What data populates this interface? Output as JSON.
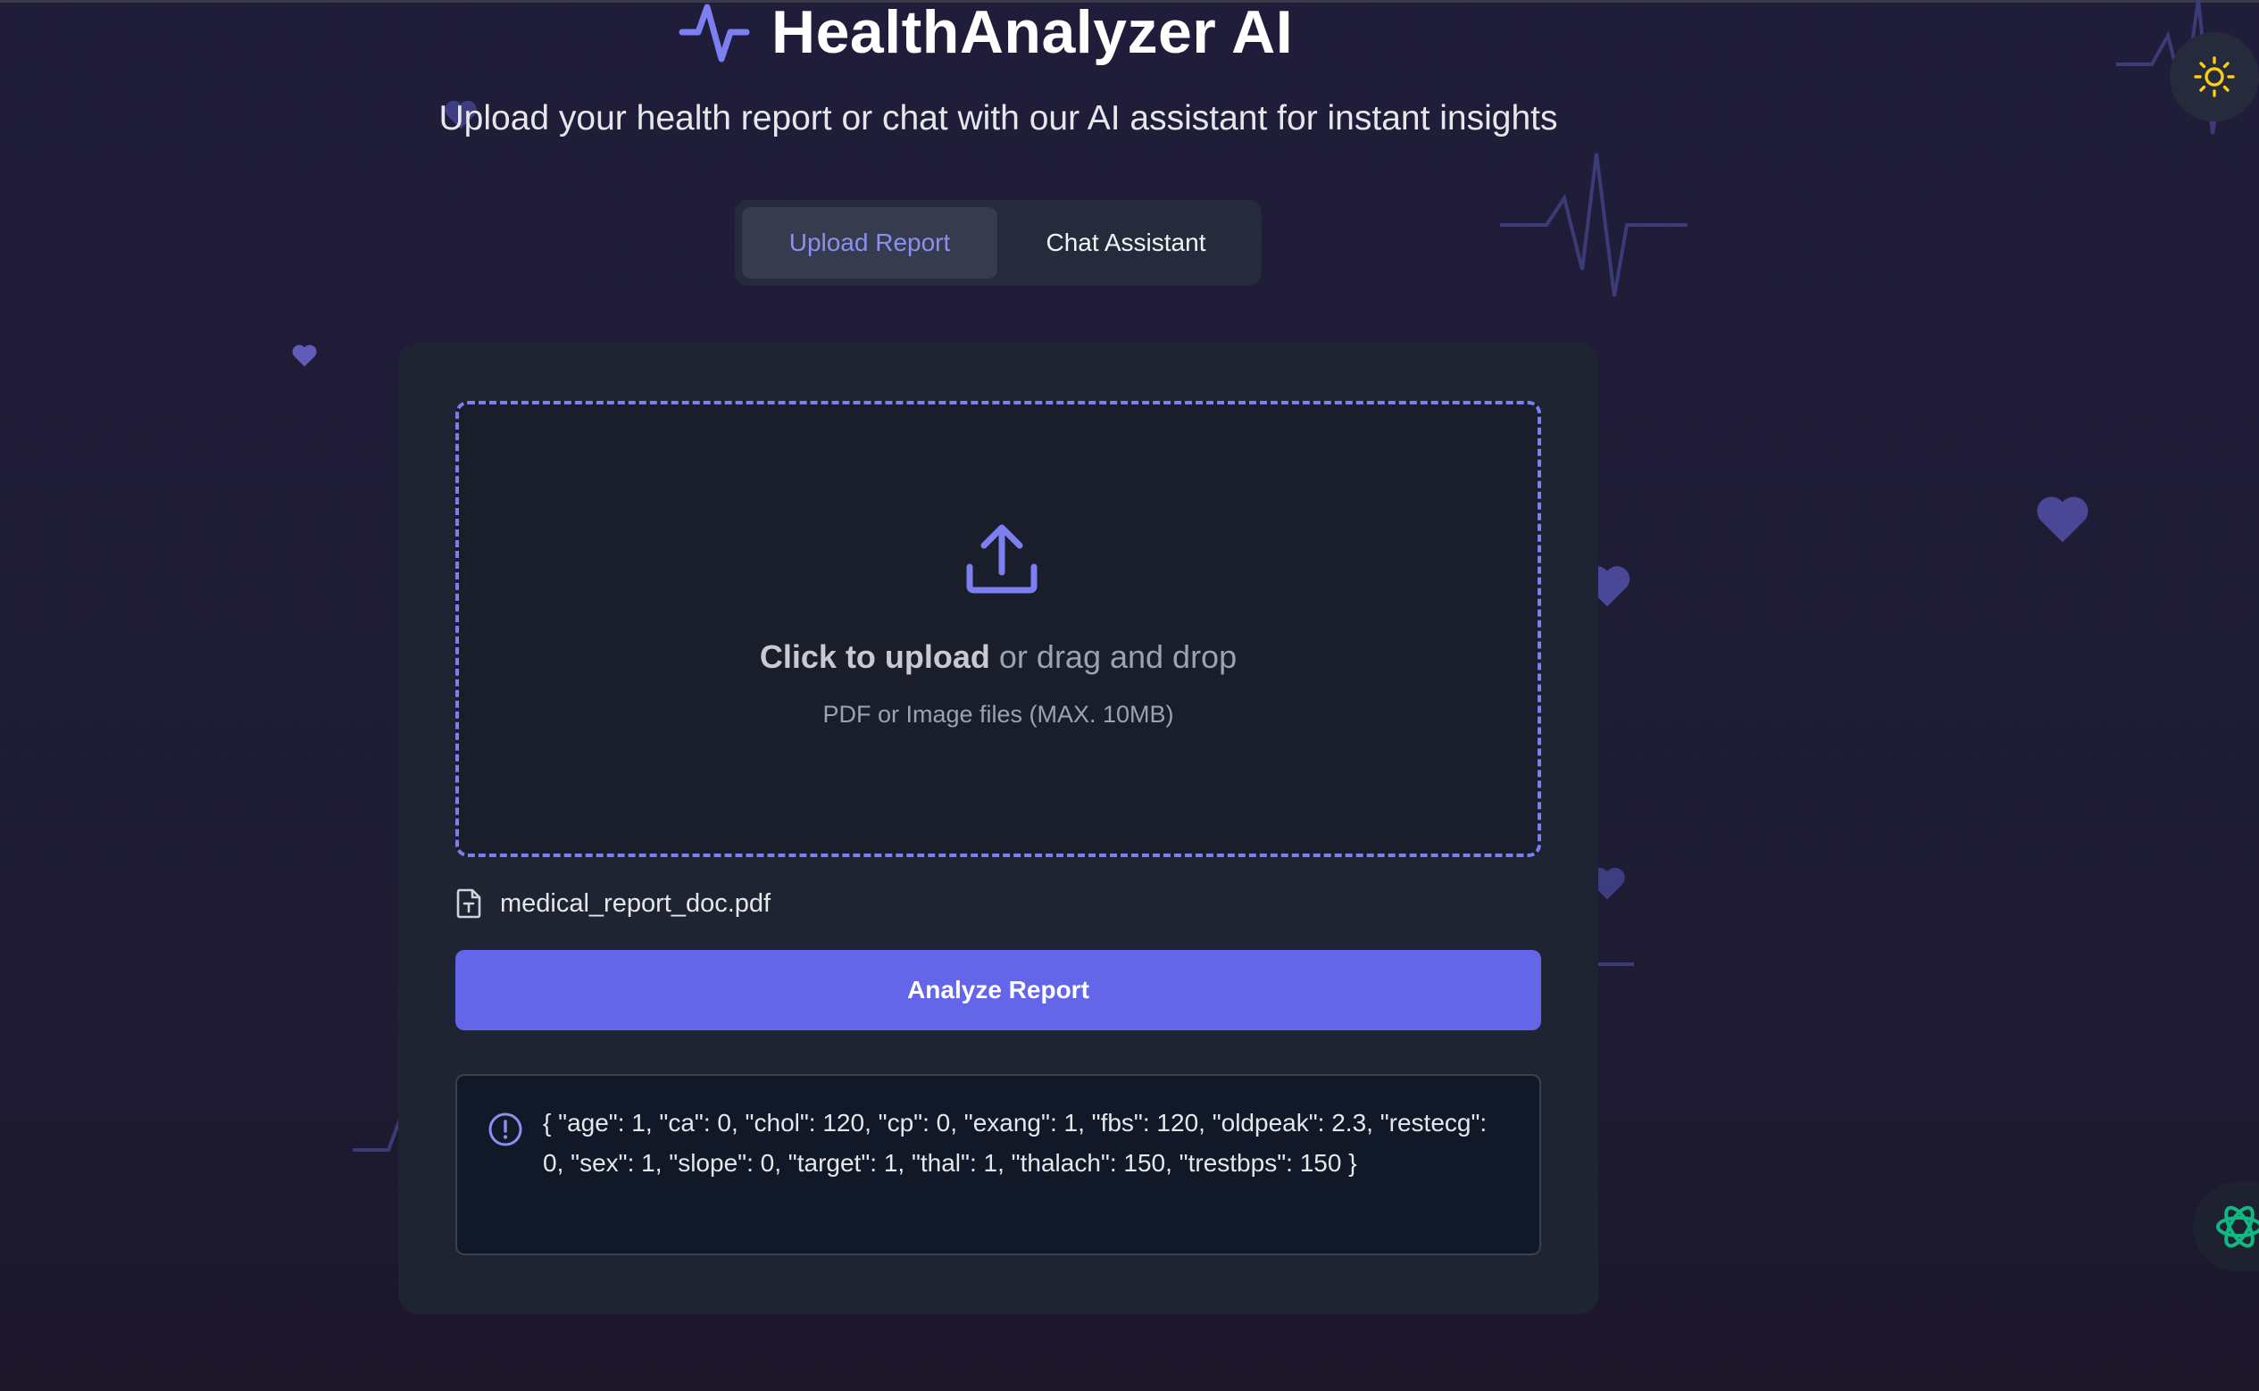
{
  "header": {
    "title": "HealthAnalyzer AI",
    "subtitle": "Upload your health report or chat with our AI assistant for instant insights",
    "logo_icon": "heart-pulse-icon"
  },
  "tabs": [
    {
      "label": "Upload Report",
      "active": true
    },
    {
      "label": "Chat Assistant",
      "active": false
    }
  ],
  "upload": {
    "cta_bold": "Click to upload",
    "cta_rest": " or drag and drop",
    "hint": "PDF or Image files (MAX. 10MB)",
    "icon": "upload-icon"
  },
  "file": {
    "name": "medical_report_doc.pdf",
    "icon": "file-text-icon"
  },
  "analyze_button": {
    "label": "Analyze Report"
  },
  "result": {
    "icon": "info-icon",
    "text": "{ \"age\": 1, \"ca\": 0, \"chol\": 120, \"cp\": 0, \"exang\": 1, \"fbs\": 120, \"oldpeak\": 2.3, \"restecg\": 0, \"sex\": 1, \"slope\": 0, \"target\": 1, \"thal\": 1, \"thalach\": 150, \"trestbps\": 150 }"
  },
  "controls": {
    "theme_toggle_icon": "sun-icon",
    "chat_fab_icon": "chat-bot-icon"
  },
  "colors": {
    "accent": "#6366e9",
    "accent_light": "#8b8ff0",
    "background": "#201d3a",
    "card": "#1f2433",
    "sun": "#facc15",
    "bot": "#10b981"
  }
}
